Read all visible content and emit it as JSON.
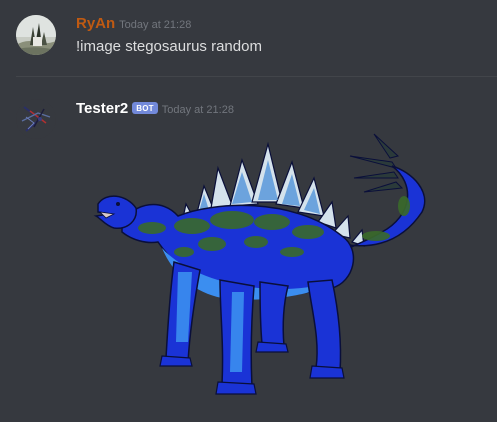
{
  "messages": [
    {
      "author": "RyAn",
      "author_color": "#c05a12",
      "timestamp": "Today at 21:28",
      "content": "!image stegosaurus random",
      "avatar_icon": "landscape-avatar-icon"
    },
    {
      "author": "Tester2",
      "author_color": "#ffffff",
      "badge": "BOT",
      "badge_color": "#7289da",
      "timestamp": "Today at 21:28",
      "avatar_icon": "bot-avatar-icon",
      "attachment": {
        "type": "image",
        "subject": "stegosaurus",
        "colors": {
          "body": "#1a33d6",
          "belly": "#3b8ef0",
          "camo": "#3a6a2b",
          "plates": "#d4e2ec",
          "outline": "#0a0f3a"
        }
      }
    }
  ]
}
